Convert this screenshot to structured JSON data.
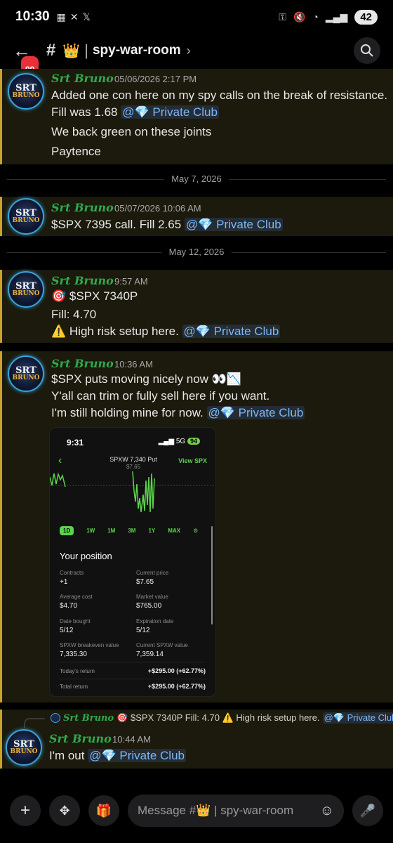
{
  "status": {
    "time": "10:30",
    "battery": "42",
    "signal_sup": "5"
  },
  "header": {
    "badge": "99",
    "channel_emoji": "👑",
    "channel_name": "spy-war-room"
  },
  "messages": [
    {
      "author": "Srt Bruno",
      "timestamp": "05/06/2026 2:17 PM",
      "lines": [
        "Added one con here on my spy calls on the break of resistance.",
        "Fill was 1.68",
        "We back green on these joints",
        "Paytence"
      ],
      "mention": "@💎 Private Club"
    },
    {
      "date_divider": "May 7, 2026",
      "author": "Srt Bruno",
      "timestamp": "05/07/2026 10:06 AM",
      "lines": [
        "$SPX 7395 call.  Fill 2.65"
      ],
      "mention": "@💎 Private Club"
    },
    {
      "date_divider": "May 12, 2026",
      "author": "Srt Bruno",
      "timestamp": "9:57 AM",
      "lines": [
        "🎯 $SPX 7340P",
        "Fill: 4.70",
        "⚠️ High risk setup here."
      ],
      "mention": "@💎 Private Club"
    },
    {
      "author": "Srt Bruno",
      "timestamp": "10:36 AM",
      "lines": [
        "$SPX puts moving nicely now 👀📉",
        "Y'all can trim or fully sell here if you want.",
        "I'm still holding mine for now."
      ],
      "mention": "@💎 Private Club"
    },
    {
      "reply_to": {
        "author": "Srt Bruno",
        "text": "🎯 $SPX 7340P Fill: 4.70 ⚠️ High risk setup here.",
        "mention": "@💎 Private Club"
      },
      "author": "Srt Bruno",
      "timestamp": "10:44 AM",
      "lines": [
        "I'm out"
      ],
      "mention": "@💎 Private Club"
    }
  ],
  "avatar": {
    "line1": "SRT",
    "line2": "BRUNO"
  },
  "attachment": {
    "status_time": "9:31",
    "status_net": "5G",
    "status_batt": "94",
    "title": "SPXW 7,340 Put",
    "price": "$7.65",
    "view_link": "View SPX",
    "ranges": [
      "1D",
      "1W",
      "1M",
      "3M",
      "1Y",
      "MAX"
    ],
    "selected_range": "1D",
    "position_title": "Your position",
    "fields": [
      {
        "label": "Contracts",
        "value": "+1"
      },
      {
        "label": "Current price",
        "value": "$7.65"
      },
      {
        "label": "Average cost",
        "value": "$4.70"
      },
      {
        "label": "Market value",
        "value": "$765.00"
      },
      {
        "label": "Date bought",
        "value": "5/12"
      },
      {
        "label": "Expiration date",
        "value": "5/12"
      },
      {
        "label": "SPXW breakeven value",
        "value": "7,335.30"
      },
      {
        "label": "Current SPXW value",
        "value": "7,359.14"
      }
    ],
    "todays_return_label": "Today's return",
    "todays_return_value": "+$295.00 (+62.77%)",
    "total_return_label": "Total return",
    "total_return_value": "+$295.00 (+62.77%)"
  },
  "composer": {
    "placeholder_prefix": "Message #",
    "placeholder_emoji": "👑",
    "placeholder_channel": "spy-war-room"
  },
  "colors": {
    "author": "#2fa94e",
    "highlight_bar": "#c9a227",
    "mention": "#7db8f5",
    "robinhood_green": "#5bd64a"
  }
}
